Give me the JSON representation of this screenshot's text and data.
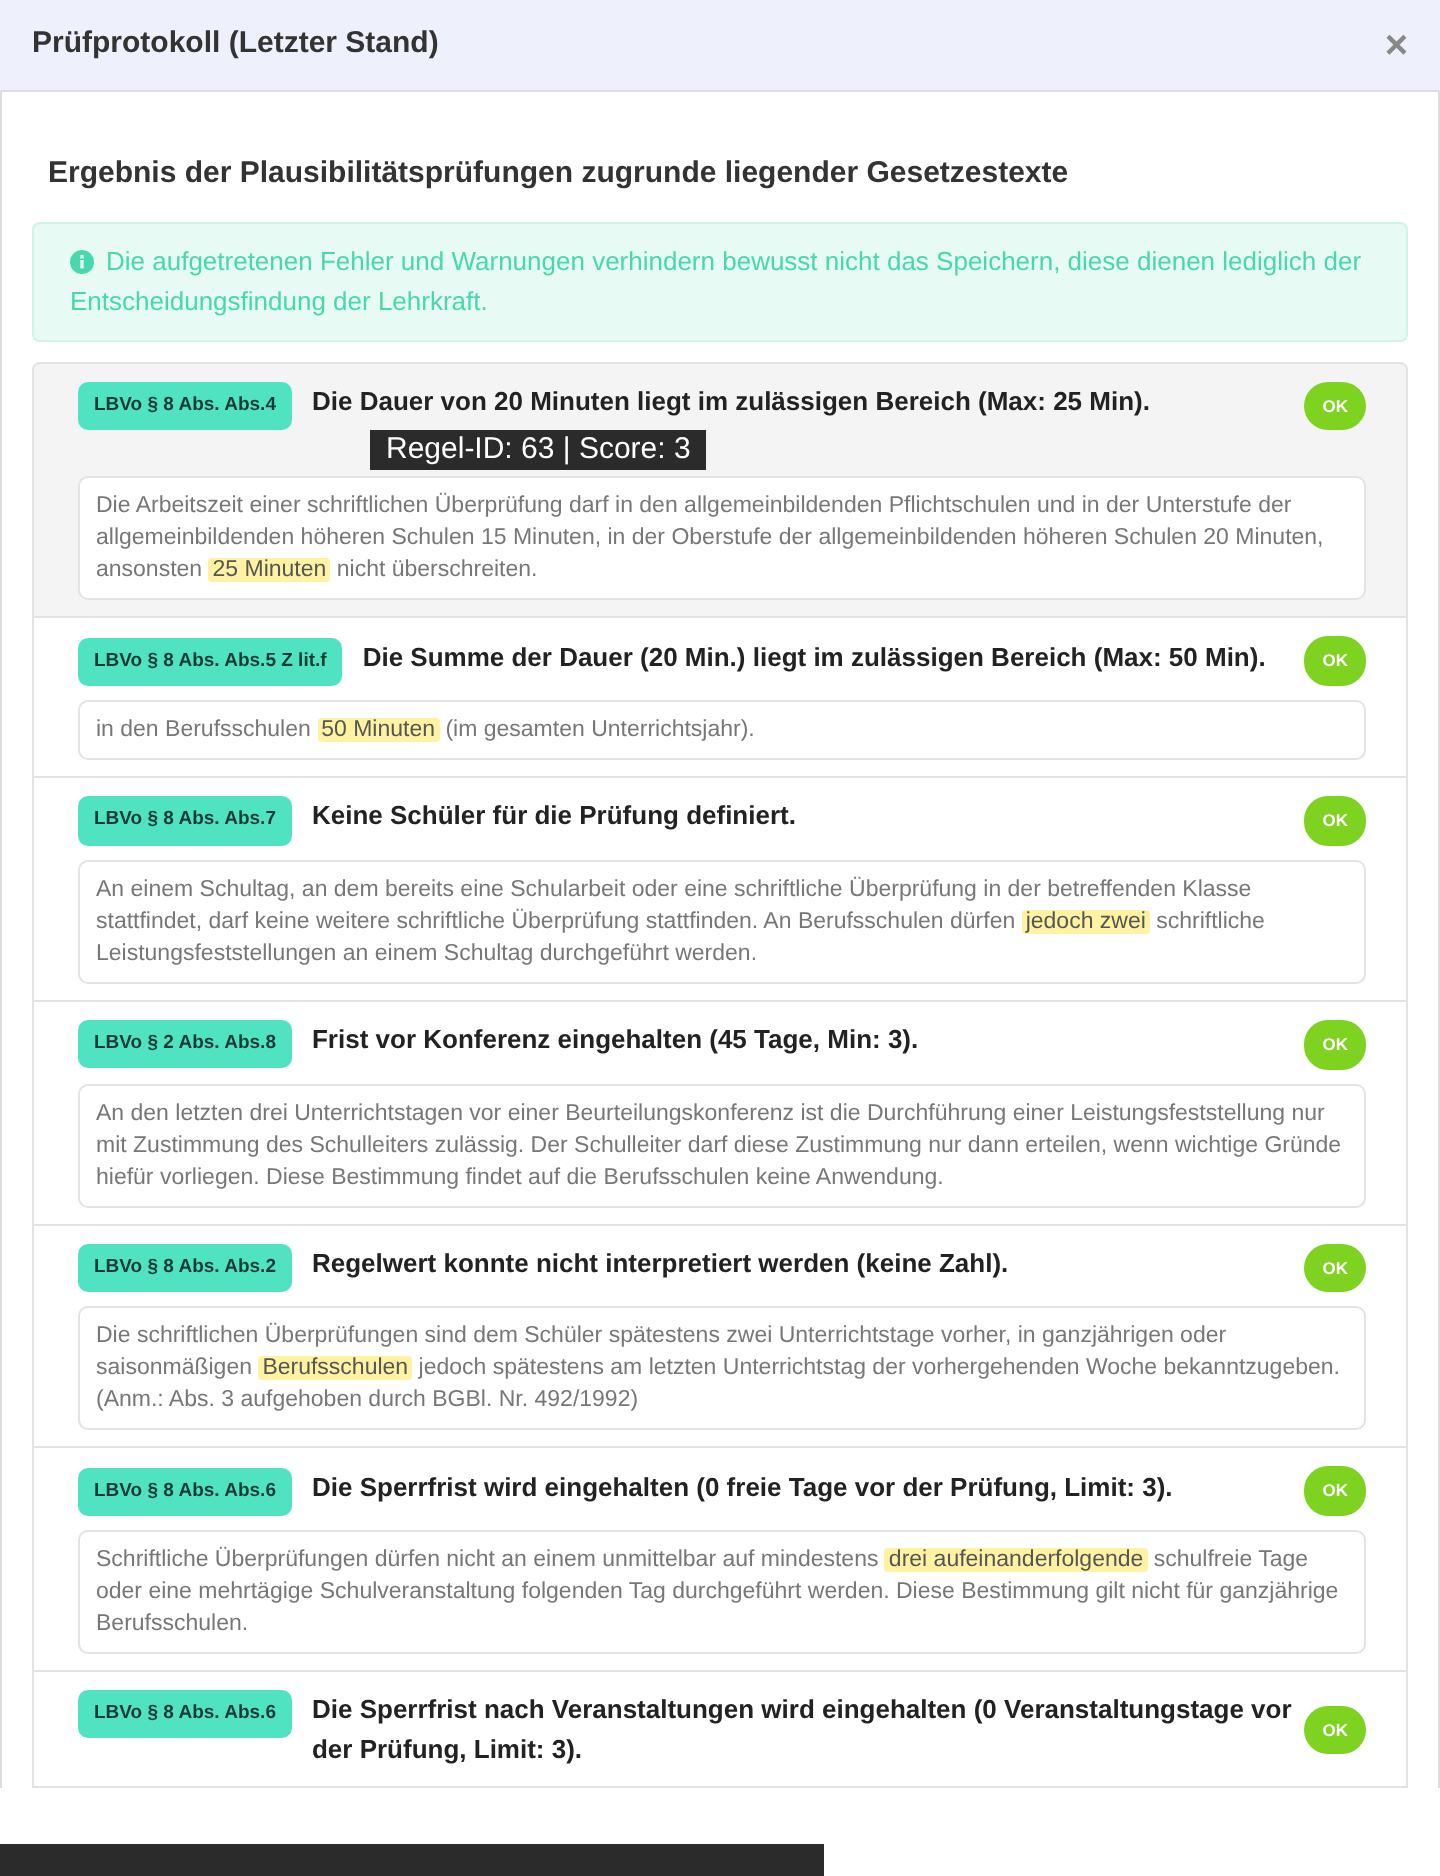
{
  "modal": {
    "title": "Prüfprotokoll (Letzter Stand)",
    "close": "×"
  },
  "heading": "Ergebnis der Plausibilitätsprüfungen zugrunde liegender Gesetzestexte",
  "alert": {
    "text": "Die aufgetretenen Fehler und Warnungen verhindern bewusst nicht das Speichern, diese dienen lediglich der Entscheidungsfindung der Lehrkraft."
  },
  "checks": [
    {
      "law": "LBVo § 8 Abs. Abs.4",
      "result": "Die Dauer von 20 Minuten liegt im zulässigen Bereich (Max: 25 Min).",
      "status": "OK",
      "tooltip": "Regel-ID: 63 | Score: 3",
      "text": "Die Arbeitszeit einer schriftlichen Überprüfung darf in den allgemeinbildenden Pflichtschulen und in der Unterstufe der allgemeinbildenden höheren Schulen 15 Minuten, in der Oberstufe der allgemeinbildenden höheren Schulen 20 Minuten, ansonsten ",
      "highlight": "25 Minuten",
      "text_after": " nicht überschreiten."
    },
    {
      "law": "LBVo § 8 Abs. Abs.5 Z lit.f",
      "result": "Die Summe der Dauer (20 Min.) liegt im zulässigen Bereich (Max: 50 Min).",
      "status": "OK",
      "text": "in den Berufsschulen ",
      "highlight": "50 Minuten",
      "text_after": " (im gesamten Unterrichtsjahr)."
    },
    {
      "law": "LBVo § 8 Abs. Abs.7",
      "result": "Keine Schüler für die Prüfung definiert.",
      "status": "OK",
      "text": "An einem Schultag, an dem bereits eine Schularbeit oder eine schriftliche Überprüfung in der betreffenden Klasse stattfindet, darf keine weitere schriftliche Überprüfung stattfinden. An Berufsschulen dürfen ",
      "highlight": "jedoch zwei",
      "text_after": " schriftliche Leistungsfeststellungen an einem Schultag durchgeführt werden."
    },
    {
      "law": "LBVo § 2 Abs. Abs.8",
      "result": "Frist vor Konferenz eingehalten (45 Tage, Min: 3).",
      "status": "OK",
      "text": "An den letzten drei Unterrichtstagen vor einer Beurteilungskonferenz ist die Durchführung einer Leistungsfeststellung nur mit Zustimmung des Schulleiters zulässig. Der Schulleiter darf diese Zustimmung nur dann erteilen, wenn wichtige Gründe hiefür vorliegen. Diese Bestimmung findet auf die Berufsschulen keine Anwendung."
    },
    {
      "law": "LBVo § 8 Abs. Abs.2",
      "result": "Regelwert konnte nicht interpretiert werden (keine Zahl).",
      "status": "OK",
      "text": "Die schriftlichen Überprüfungen sind dem Schüler spätestens zwei Unterrichtstage vorher, in ganzjährigen oder saisonmäßigen ",
      "highlight": "Berufsschulen",
      "text_after": " jedoch spätestens am letzten Unterrichtstag der vorhergehenden Woche bekanntzugeben. (Anm.: Abs. 3 aufgehoben durch BGBl. Nr. 492/1992)"
    },
    {
      "law": "LBVo § 8 Abs. Abs.6",
      "result": "Die Sperrfrist wird eingehalten (0 freie Tage vor der Prüfung, Limit: 3).",
      "status": "OK",
      "text": "Schriftliche Überprüfungen dürfen nicht an einem unmittelbar auf mindestens ",
      "highlight": "drei aufeinanderfolgende",
      "text_after": " schulfreie Tage oder eine mehrtägige Schulveranstaltung folgenden Tag durchgeführt werden. Diese Bestimmung gilt nicht für ganzjährige Berufsschulen."
    },
    {
      "law": "LBVo § 8 Abs. Abs.6",
      "result": "Die Sperrfrist nach Veranstaltungen wird eingehalten (0 Veranstaltungstage vor der Prüfung, Limit: 3).",
      "status": "OK"
    }
  ]
}
